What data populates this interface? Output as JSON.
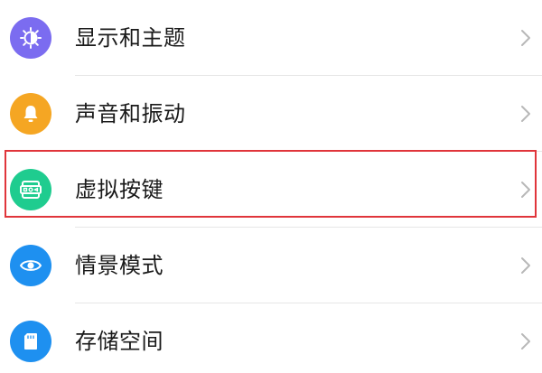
{
  "settings": {
    "items": [
      {
        "label": "显示和主题",
        "icon": "display-theme-icon",
        "icon_color": "#7B6CF0"
      },
      {
        "label": "声音和振动",
        "icon": "bell-icon",
        "icon_color": "#F5A623"
      },
      {
        "label": "虚拟按键",
        "icon": "virtual-keys-icon",
        "icon_color": "#1FCC8F"
      },
      {
        "label": "情景模式",
        "icon": "eye-icon",
        "icon_color": "#1E90F0"
      },
      {
        "label": "存储空间",
        "icon": "sd-card-icon",
        "icon_color": "#1E90F0"
      }
    ],
    "highlighted_item": "虚拟按键",
    "highlight_color": "#E0353B"
  }
}
